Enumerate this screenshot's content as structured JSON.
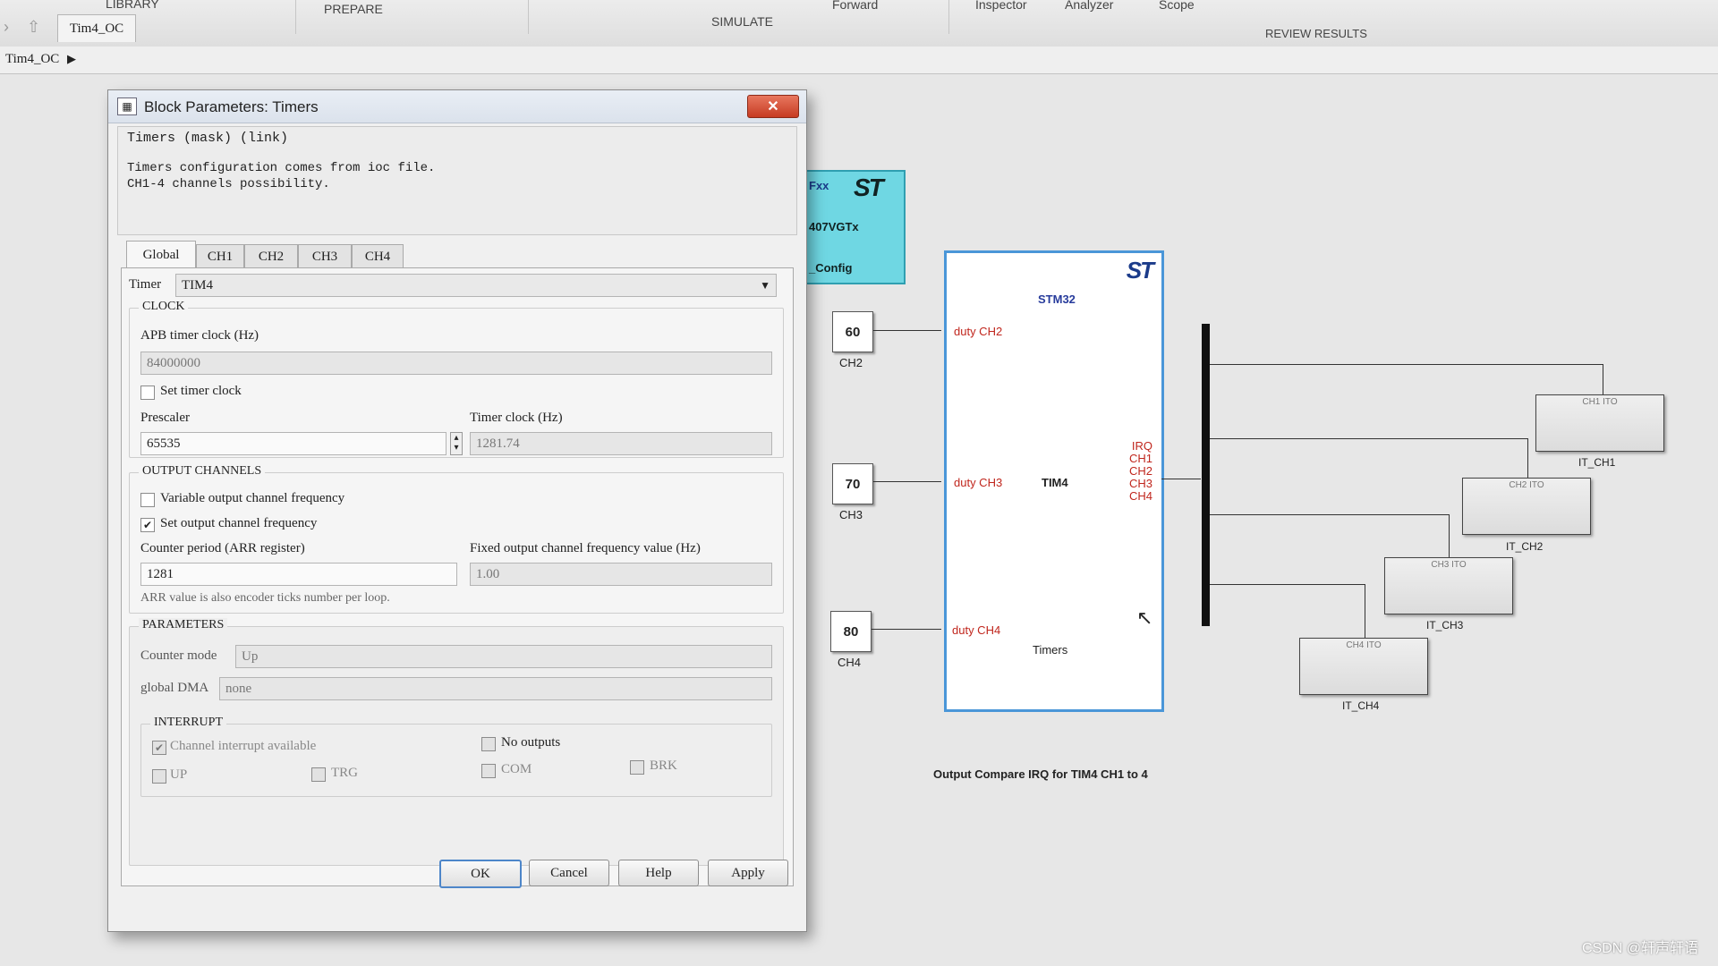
{
  "ribbon": {
    "library_label": "LIBRARY",
    "prepare_label": "PREPARE",
    "simulate_label": "SIMULATE",
    "forward_label": "Forward",
    "inspector_label": "Inspector",
    "analyzer_label": "Analyzer",
    "scope_label": "Scope",
    "review_label": "REVIEW RESULTS"
  },
  "model_tab": "Tim4_OC",
  "breadcrumb": "Tim4_OC",
  "dialog": {
    "title": "Block Parameters: Timers",
    "close_label": "✕",
    "header": "Timers (mask) (link)",
    "desc_line1": "Timers configuration comes from ioc file.",
    "desc_line2": "CH1-4 channels possibility.",
    "tabs": [
      "Global",
      "CH1",
      "CH2",
      "CH3",
      "CH4"
    ],
    "timer_label": "Timer",
    "timer_value": "TIM4",
    "clock": {
      "title": "CLOCK",
      "apb_label": "APB timer clock (Hz)",
      "apb_value": "84000000",
      "set_timer_clock_label": "Set timer clock",
      "prescaler_label": "Prescaler",
      "prescaler_value": "65535",
      "timer_clock_label": "Timer clock (Hz)",
      "timer_clock_value": "1281.74"
    },
    "output": {
      "title": "OUTPUT CHANNELS",
      "variable_label": "Variable output channel frequency",
      "set_label": "Set output channel frequency",
      "counter_label": "Counter period (ARR register)",
      "counter_value": "1281",
      "fixed_label": "Fixed output channel frequency value (Hz)",
      "fixed_value": "1.00",
      "hint": "ARR value is also encoder ticks number per loop."
    },
    "params": {
      "title": "PARAMETERS",
      "counter_mode_label": "Counter mode",
      "counter_mode_value": "Up",
      "dma_label": "global DMA",
      "dma_value": "none"
    },
    "interrupt": {
      "title": "INTERRUPT",
      "channel_label": "Channel interrupt available",
      "no_outputs_label": "No outputs",
      "up_label": "UP",
      "trg_label": "TRG",
      "com_label": "COM",
      "brk_label": "BRK"
    },
    "buttons": {
      "ok": "OK",
      "cancel": "Cancel",
      "help": "Help",
      "apply": "Apply"
    }
  },
  "diagram": {
    "config_line1": "Fxx",
    "config_line2": "407VGTx",
    "config_line3": "_Config",
    "st_logo": "ST",
    "constants": [
      {
        "value": "60",
        "name": "CH2"
      },
      {
        "value": "70",
        "name": "CH3"
      },
      {
        "value": "80",
        "name": "CH4"
      }
    ],
    "timers": {
      "brand": "STM32",
      "center": "TIM4",
      "name": "Timers",
      "inputs": [
        "duty CH2",
        "duty CH3",
        "duty CH4"
      ],
      "outputs": [
        "IRQ",
        "CH1",
        "CH2",
        "CH3",
        "CH4"
      ]
    },
    "it_blocks": [
      {
        "inner": "CH1 ITO",
        "name": "IT_CH1"
      },
      {
        "inner": "CH2 ITO",
        "name": "IT_CH2"
      },
      {
        "inner": "CH3 ITO",
        "name": "IT_CH3"
      },
      {
        "inner": "CH4 ITO",
        "name": "IT_CH4"
      }
    ],
    "caption": "Output Compare IRQ for TIM4 CH1 to 4"
  },
  "watermark": "CSDN @轩声轩语"
}
